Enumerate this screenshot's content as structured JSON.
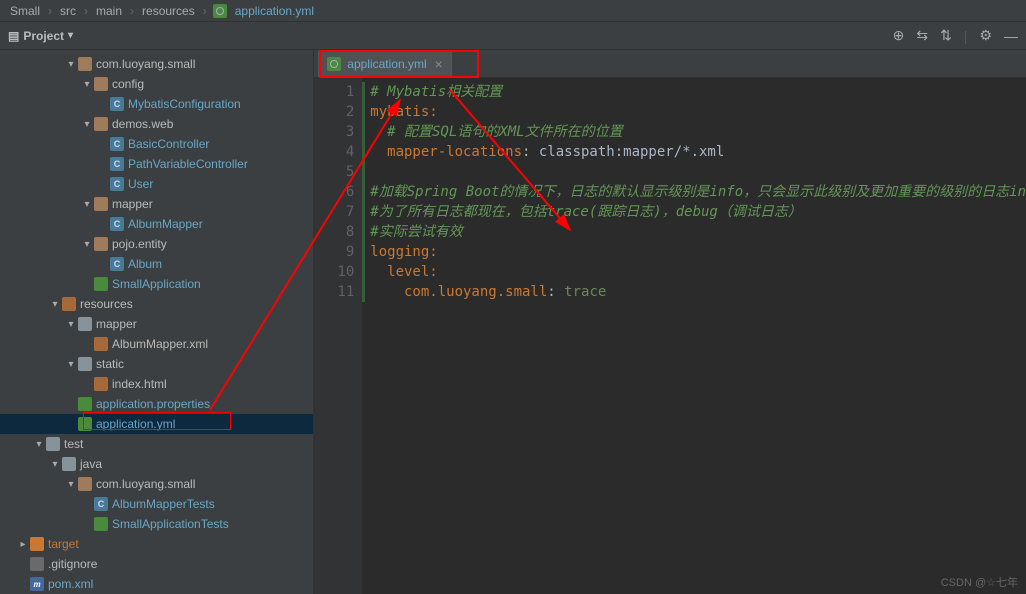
{
  "breadcrumb": [
    "Small",
    "src",
    "main",
    "resources",
    "application.yml"
  ],
  "project_label": "Project",
  "editor_tab": {
    "label": "application.yml"
  },
  "tree": {
    "n0": "com.luoyang.small",
    "n1": "config",
    "n2": "MybatisConfiguration",
    "n3": "demos.web",
    "n4": "BasicController",
    "n5": "PathVariableController",
    "n6": "User",
    "n7": "mapper",
    "n8": "AlbumMapper",
    "n9": "pojo.entity",
    "n10": "Album",
    "n11": "SmallApplication",
    "n12": "resources",
    "n13": "mapper",
    "n14": "AlbumMapper.xml",
    "n15": "static",
    "n16": "index.html",
    "n17": "application.properties",
    "n18": "application.yml",
    "n19": "test",
    "n20": "java",
    "n21": "com.luoyang.small",
    "n22": "AlbumMapperTests",
    "n23": "SmallApplicationTests",
    "n24": "target",
    "n25": ".gitignore",
    "n26": "pom.xml"
  },
  "code": {
    "l1a": "# Mybatis",
    "l1b": "相关配置",
    "l2": "mybatis:",
    "l3a": "# ",
    "l3b": "配置SQL语句的XML文件所在的位置",
    "l3sql": "SQL",
    "l3xml": "XML",
    "l4k": "mapper-locations",
    "l4v": ": classpath:mapper/*.xml",
    "l6a": "#加载Spring Boot的情况下，日志的默认显示级别是info，只会显示此级别及更加重要的级别的日志in",
    "l7a": "#为了所有日志都现在，包括trace(跟踪日志)，debug（调试日志）",
    "l8a": "#实际尝试有效",
    "l9": "logging:",
    "l10": "level:",
    "l11k": "com.luoyang.small",
    "l11v": "trace"
  },
  "watermark": "CSDN @☆七年"
}
